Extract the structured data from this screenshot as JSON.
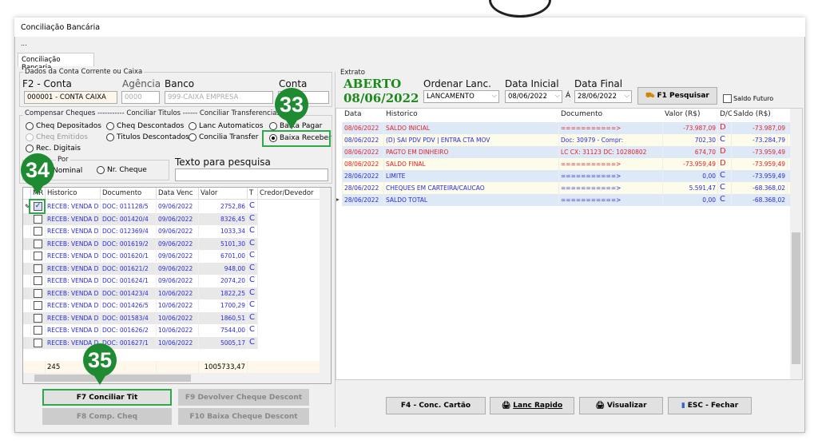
{
  "window": {
    "title": "Conciliação Bancária",
    "menu": "...",
    "tab": "Conciliação Bancaria"
  },
  "conta": {
    "group_label": "Dados da Conta Corrente ou Caixa",
    "conta_label": "F2 - Conta",
    "conta_value": "000001 - CONTA CAIXA",
    "agencia_label": "Agência",
    "agencia_value": "0000",
    "banco_label": "Banco",
    "banco_value": "999-CAIXA EMPRESA",
    "conta2_label": "Conta",
    "conta2_value": ""
  },
  "compensar": {
    "group_label": "Compensar Cheques ----------- Conciliar Titulos ------ Conciliar Transferencias",
    "options": [
      {
        "label": "Cheq Depositados",
        "checked": false,
        "disabled": false
      },
      {
        "label": "Cheq Descontados",
        "checked": false,
        "disabled": false
      },
      {
        "label": "Lanc Automaticos",
        "checked": false,
        "disabled": false
      },
      {
        "label": "Baixa Pagar",
        "checked": false,
        "disabled": false
      },
      {
        "label": "Cheq Emitidos",
        "checked": false,
        "disabled": true
      },
      {
        "label": "Titulos Descontados",
        "checked": false,
        "disabled": false
      },
      {
        "label": "Concilia Transfer",
        "checked": false,
        "disabled": false
      },
      {
        "label": "Baixa Receber",
        "checked": true,
        "disabled": false
      },
      {
        "label": "Rec. Digitais",
        "checked": false,
        "disabled": false
      }
    ]
  },
  "por": {
    "label": "Por",
    "opt1": "Cont/Nominal",
    "opt2": "Nr. Cheque"
  },
  "search": {
    "label": "Texto para pesquisa",
    "value": ""
  },
  "titulos": {
    "columns": [
      "MR",
      "Historico",
      "Documento",
      "Data Venc",
      "Valor",
      "T",
      "Credor/Devedor"
    ],
    "rows": [
      {
        "checked": true,
        "hist": "RECEB: VENDA D",
        "doc": "DOC: 011128/5",
        "venc": "09/06/2022",
        "valor": "2752,86",
        "t": "C"
      },
      {
        "checked": false,
        "hist": "RECEB: VENDA D",
        "doc": "DOC: 001420/4",
        "venc": "09/06/2022",
        "valor": "8326,45",
        "t": "C"
      },
      {
        "checked": false,
        "hist": "RECEB: VENDA D",
        "doc": "DOC: 012369/4",
        "venc": "09/06/2022",
        "valor": "1033,34",
        "t": "C"
      },
      {
        "checked": false,
        "hist": "RECEB: VENDA D",
        "doc": "DOC: 001619/2",
        "venc": "09/06/2022",
        "valor": "5101,30",
        "t": "C"
      },
      {
        "checked": false,
        "hist": "RECEB: VENDA D",
        "doc": "DOC: 001620/1",
        "venc": "09/06/2022",
        "valor": "6701,00",
        "t": "C"
      },
      {
        "checked": false,
        "hist": "RECEB: VENDA D",
        "doc": "DOC: 001621/2",
        "venc": "09/06/2022",
        "valor": "948,00",
        "t": "C"
      },
      {
        "checked": false,
        "hist": "RECEB: VENDA D",
        "doc": "DOC: 001624/1",
        "venc": "09/06/2022",
        "valor": "2074,20",
        "t": "C"
      },
      {
        "checked": false,
        "hist": "RECEB: VENDA D",
        "doc": "DOC: 001423/4",
        "venc": "10/06/2022",
        "valor": "1822,25",
        "t": "C"
      },
      {
        "checked": false,
        "hist": "RECEB: VENDA D",
        "doc": "DOC: 001426/5",
        "venc": "10/06/2022",
        "valor": "1700,29",
        "t": "C"
      },
      {
        "checked": false,
        "hist": "RECEB: VENDA D",
        "doc": "DOC: 001583/4",
        "venc": "10/06/2022",
        "valor": "1860,51",
        "t": "C"
      },
      {
        "checked": false,
        "hist": "RECEB: VENDA D",
        "doc": "DOC: 001626/2",
        "venc": "10/06/2022",
        "valor": "7544,00",
        "t": "C"
      },
      {
        "checked": false,
        "hist": "RECEB: VENDA D",
        "doc": "DOC: 001627/1",
        "venc": "10/06/2022",
        "valor": "5005,17",
        "t": "C"
      }
    ],
    "footer_count": "245",
    "footer_total": "1005733,47"
  },
  "left_buttons": {
    "f7": "F7 Conciliar Tit",
    "f9": "F9 Devolver Cheque Descont",
    "f8": "F8 Comp. Cheq",
    "f10": "F10 Baixa Cheque Descont"
  },
  "extrato": {
    "group_label": "Extrato",
    "status": "ABERTO",
    "status_date": "08/06/2022",
    "ordenar_label": "Ordenar Lanc.",
    "ordenar_value": "LANCAMENTO",
    "data_inicial_label": "Data Inicial",
    "data_inicial": "08/06/2022",
    "a_label": "Á",
    "data_final_label": "Data Final",
    "data_final": "28/06/2022",
    "pesquisar": "F1 Pesquisar",
    "saldo_futuro": "Saldo Futuro",
    "columns": [
      "Data",
      "Historico",
      "Documento",
      "Valor (R$)",
      "D/C",
      "Saldo (R$)"
    ],
    "rows": [
      {
        "data": "08/06/2022",
        "hist": "SALDO INICIAL",
        "doc": "===========>",
        "valor": "-73.987,09",
        "dc": "D",
        "saldo": "-73.987,09",
        "color": "red"
      },
      {
        "data": "08/06/2022",
        "hist": "(D) SAI PDV PDV | ENTRA CTA MOV",
        "doc": "Doc: 30979 -  Compr:",
        "valor": "702,30",
        "dc": "C",
        "saldo": "-73.284,79",
        "color": "blue"
      },
      {
        "data": "08/06/2022",
        "hist": "PAGTO EM DINHEIRO",
        "doc": "LC CX: 31123 DC: 10280802",
        "valor": "674,70",
        "dc": "D",
        "saldo": "-73.959,49",
        "color": "red"
      },
      {
        "data": "08/06/2022",
        "hist": "SALDO FINAL",
        "doc": "===========>",
        "valor": "-73.959,49",
        "dc": "D",
        "saldo": "-73.959,49",
        "color": "red"
      },
      {
        "data": "28/06/2022",
        "hist": "LIMITE",
        "doc": "===========>",
        "valor": "0,00",
        "dc": "C",
        "saldo": "-73.959,49",
        "color": "blue"
      },
      {
        "data": "28/06/2022",
        "hist": "CHEQUES EM CARTEIRA/CAUCAO",
        "doc": "===========>",
        "valor": "5.591,47",
        "dc": "C",
        "saldo": "-68.368,02",
        "color": "blue"
      },
      {
        "data": "28/06/2022",
        "hist": "SALDO TOTAL",
        "doc": "===========>",
        "valor": "0,00",
        "dc": "C",
        "saldo": "-68.368,02",
        "color": "blue"
      }
    ]
  },
  "right_buttons": {
    "f4": "F4 - Conc. Cartão",
    "lanc": "Lanc Rapido",
    "visualizar": "Visualizar",
    "esc": "ESC - Fechar"
  },
  "markers": [
    "33",
    "34",
    "35"
  ],
  "colors": {
    "red": "#e8202a",
    "blue": "#2b2be0",
    "green_status": "#1a8a1a",
    "marker": "#1e8a32"
  }
}
